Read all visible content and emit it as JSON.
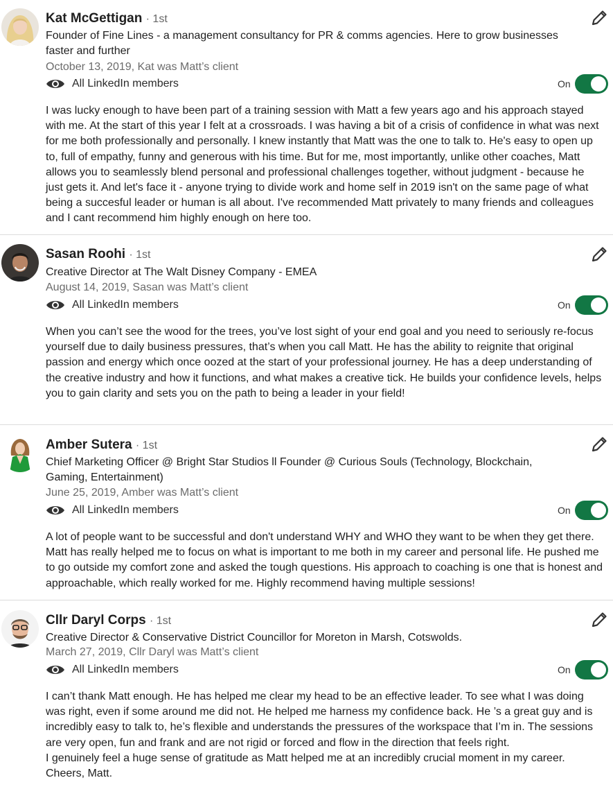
{
  "recommendations": [
    {
      "name": "Kat McGettigan",
      "degree": "· 1st",
      "headline": "Founder of Fine Lines - a management consultancy for PR & comms agencies. Here to grow businesses faster and further",
      "date": "October 13, 2019, Kat was Matt’s client",
      "visibility": "All LinkedIn members",
      "toggle_label": "On",
      "text": "I was lucky enough to have been part of a training session with Matt a few years ago and his approach stayed with me. At the start of this year I felt at a crossroads. I was having a bit of a crisis of confidence in what was next for me both professionally and personally. I knew instantly that Matt was the one to talk to. He's easy to open up to, full of empathy, funny and generous with his time. But for me, most importantly, unlike other coaches, Matt allows you to seamlessly blend personal and professional challenges together, without judgment - because he just gets it. And let's face it - anyone trying to divide work and home self in 2019 isn't on the same page of what being a succesful leader or human is all about. I've recommended Matt privately to many friends and colleagues and I cant recommend him highly enough on here too."
    },
    {
      "name": "Sasan Roohi",
      "degree": "· 1st",
      "headline": "Creative Director at The Walt Disney Company - EMEA",
      "date": "August 14, 2019, Sasan was Matt’s client",
      "visibility": "All LinkedIn members",
      "toggle_label": "On",
      "text": "When you can’t see the wood for the trees, you’ve lost sight of your end goal and you need to seriously re-focus yourself due to daily business pressures, that’s when you call Matt. He has the ability to reignite that original passion and energy which once oozed at the start of your professional journey. He has a deep understanding of the creative industry and how it functions, and what makes a creative tick. He builds your confidence levels, helps you to gain clarity and sets you on the path to being a leader in your field!"
    },
    {
      "name": "Amber Sutera",
      "degree": "· 1st",
      "headline": "Chief Marketing Officer @ Bright Star Studios ll Founder @ Curious Souls (Technology, Blockchain, Gaming, Entertainment)",
      "date": "June 25, 2019, Amber was Matt’s client",
      "visibility": "All LinkedIn members",
      "toggle_label": "On",
      "text": "A lot of people want to be successful and don't understand WHY and WHO they want to be when they get there. Matt has really helped me to focus on what is important to me both in my career and personal life. He pushed me to go outside my comfort zone and asked the tough questions. His approach to coaching is one that is honest and approachable, which really worked for me. Highly recommend having multiple sessions!"
    },
    {
      "name": "Cllr Daryl Corps",
      "degree": "· 1st",
      "headline": "Creative Director & Conservative District Councillor for Moreton in Marsh, Cotswolds.",
      "date": "March 27, 2019, Cllr Daryl was Matt’s client",
      "visibility": "All LinkedIn members",
      "toggle_label": "On",
      "text": "I can’t thank Matt enough. He has helped me clear my head to be an effective leader. To see what I was doing was right, even if some around me did not. He helped me harness my confidence back. He ’s a great guy and is incredibly easy to talk to, he’s flexible and understands the pressures of the workspace that I’m in. The sessions are very open, fun and frank and are not rigid or forced and flow in the direction that feels right.\nI genuinely feel a huge sense of gratitude as Matt helped me at an incredibly crucial moment in my career. Cheers, Matt."
    }
  ],
  "colors": {
    "toggle_on": "#127744",
    "meta_text": "#6b6b6b",
    "divider": "#dcdcdc"
  }
}
